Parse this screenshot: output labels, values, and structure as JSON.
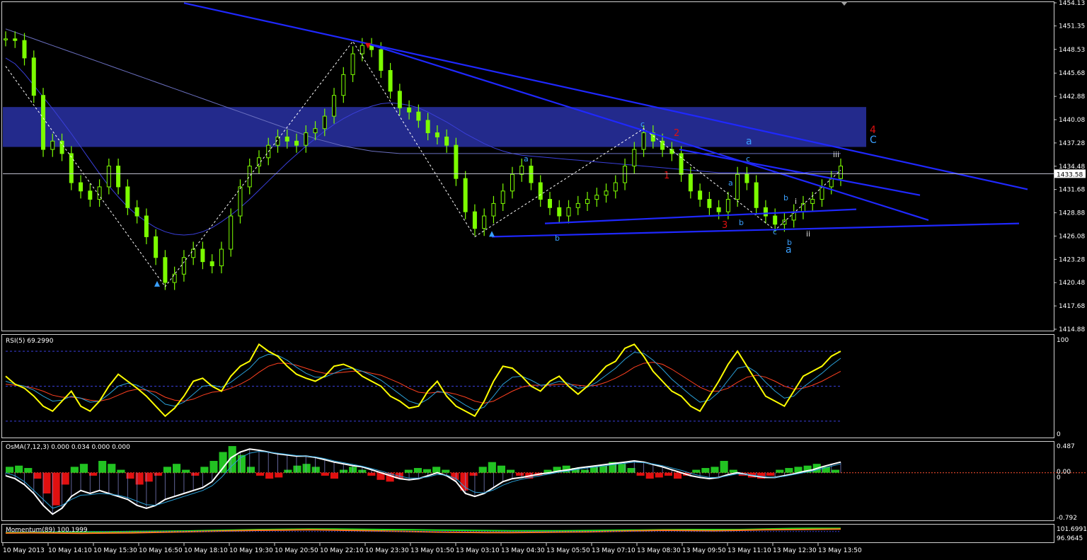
{
  "chart_data": [
    {
      "type": "candlestick",
      "panel": "price",
      "ylim": [
        1414.88,
        1454.13
      ],
      "y_ticks": [
        "1454.13",
        "1451.35",
        "1448.53",
        "1445.68",
        "1442.88",
        "1440.08",
        "1437.28",
        "1434.48",
        "1431.68",
        "1428.88",
        "1426.08",
        "1423.28",
        "1420.48",
        "1417.68",
        "1414.88"
      ],
      "current_price": "1433.58",
      "series": [
        {
          "name": "close",
          "values": [
            1449.8,
            1449.6,
            1447.5,
            1443.0,
            1436.5,
            1437.5,
            1436.0,
            1432.5,
            1431.5,
            1430.5,
            1432.0,
            1434.5,
            1432.0,
            1429.5,
            1428.5,
            1426.0,
            1423.5,
            1420.5,
            1421.5,
            1423.5,
            1424.5,
            1423.0,
            1422.5,
            1424.5,
            1428.5,
            1432.0,
            1434.5,
            1435.5,
            1437.0,
            1438.0,
            1437.5,
            1437.0,
            1438.5,
            1439.0,
            1440.5,
            1443.0,
            1445.5,
            1448.0,
            1449.0,
            1448.5,
            1446.0,
            1443.5,
            1441.5,
            1441.0,
            1440.0,
            1438.5,
            1438.0,
            1437.0,
            1433.0,
            1429.0,
            1427.0,
            1428.5,
            1430.0,
            1431.5,
            1433.5,
            1434.5,
            1432.5,
            1430.5,
            1429.5,
            1428.5,
            1429.5,
            1430.0,
            1430.5,
            1431.0,
            1431.5,
            1432.5,
            1434.5,
            1436.5,
            1438.5,
            1437.5,
            1436.5,
            1436.0,
            1433.5,
            1431.5,
            1430.5,
            1429.5,
            1429.0,
            1430.5,
            1433.5,
            1432.5,
            1429.5,
            1428.5,
            1427.5,
            1428.0,
            1429.0,
            1430.0,
            1430.5,
            1432.0,
            1433.0,
            1434.5
          ]
        },
        {
          "name": "MA1",
          "values": [
            1447.5,
            1446.8,
            1445.6,
            1444.2,
            1442.8,
            1441.4,
            1439.9,
            1438.4,
            1436.8,
            1435.2,
            1433.6,
            1432.1,
            1430.8,
            1429.6,
            1428.6,
            1427.8,
            1427.1,
            1426.6,
            1426.3,
            1426.2,
            1426.3,
            1426.6,
            1427.1,
            1427.8,
            1428.6,
            1429.5,
            1430.5,
            1431.6,
            1432.7,
            1433.8,
            1434.9,
            1435.9,
            1436.9,
            1437.8,
            1438.7,
            1439.5,
            1440.2,
            1440.8,
            1441.3,
            1441.7,
            1442.0,
            1442.1,
            1442.0,
            1441.8,
            1441.5,
            1441.0,
            1440.4,
            1439.8,
            1439.1,
            1438.4,
            1437.8,
            1437.2,
            1436.7,
            1436.3,
            1436.0,
            1435.8,
            1435.7,
            1435.6,
            1435.5,
            1435.4,
            1435.3,
            1435.2,
            1435.1,
            1435.0,
            1434.9,
            1434.8,
            1434.7,
            1434.6,
            1434.5,
            1434.4,
            1434.3,
            1434.2,
            1434.1,
            1434.0,
            1433.9,
            1433.8,
            1433.7,
            1433.7,
            1433.7,
            1433.7,
            1433.7,
            1433.7,
            1433.7,
            1433.7,
            1433.7,
            1433.7,
            1433.8,
            1433.8,
            1433.8,
            1433.8
          ]
        },
        {
          "name": "MA2",
          "values": [
            1451.0,
            1450.6,
            1450.2,
            1449.8,
            1449.4,
            1449.0,
            1448.6,
            1448.2,
            1447.8,
            1447.4,
            1447.0,
            1446.6,
            1446.2,
            1445.8,
            1445.4,
            1445.0,
            1444.6,
            1444.2,
            1443.8,
            1443.4,
            1443.0,
            1442.6,
            1442.2,
            1441.8,
            1441.4,
            1441.0,
            1440.6,
            1440.2,
            1439.8,
            1439.4,
            1439.0,
            1438.6,
            1438.2,
            1437.8,
            1437.5,
            1437.2,
            1436.9,
            1436.7,
            1436.5,
            1436.3,
            1436.2,
            1436.1,
            1436.0,
            1436.0,
            1436.0,
            1436.0,
            1436.0,
            1436.0,
            1436.0,
            1436.0,
            1436.0,
            1436.0,
            1436.0,
            1436.0,
            1436.0,
            1436.0,
            1436.0,
            1436.0,
            1436.0,
            1436.0,
            1436.0,
            1436.0,
            1436.0,
            1436.0,
            1436.0,
            1436.0,
            1436.0,
            1436.0,
            1436.0,
            1436.0,
            1436.0,
            1436.0,
            1436.0,
            1436.0,
            1436.0,
            1436.0,
            1436.0,
            1436.0,
            1436.0,
            1436.0,
            1436.0,
            1436.0,
            1436.0,
            1436.0,
            1436.0,
            1436.0,
            1436.0,
            1436.0,
            1436.0,
            1436.0
          ]
        }
      ],
      "zone": {
        "from": 1436.8,
        "to": 1441.6
      },
      "annotations_red": [
        "4",
        "2",
        "1",
        "3"
      ],
      "annotations_blue": [
        "C",
        "a",
        "a",
        "c",
        "c",
        "a",
        "b",
        "b",
        "b",
        "a",
        "c",
        "b",
        "i",
        "ii",
        "iii"
      ]
    },
    {
      "type": "line",
      "panel": "rsi",
      "title": "RSI(5) 69.2990",
      "ylim": [
        0,
        100
      ],
      "y_ticks": [
        "100",
        "0"
      ],
      "series": [
        {
          "name": "RSI",
          "values": [
            60,
            52,
            48,
            40,
            30,
            25,
            35,
            45,
            30,
            25,
            35,
            50,
            62,
            55,
            48,
            40,
            30,
            20,
            28,
            40,
            55,
            58,
            50,
            45,
            60,
            70,
            75,
            92,
            85,
            80,
            70,
            62,
            58,
            55,
            60,
            70,
            72,
            68,
            60,
            55,
            50,
            40,
            35,
            28,
            30,
            45,
            55,
            40,
            30,
            25,
            20,
            35,
            55,
            70,
            68,
            60,
            50,
            45,
            55,
            60,
            50,
            42,
            50,
            60,
            70,
            75,
            88,
            92,
            80,
            65,
            55,
            45,
            40,
            30,
            25,
            40,
            55,
            72,
            85,
            70,
            55,
            40,
            35,
            30,
            45,
            60,
            65,
            70,
            80,
            85
          ]
        },
        {
          "name": "signal",
          "values": [
            55,
            52,
            50,
            46,
            40,
            35,
            36,
            40,
            38,
            34,
            35,
            42,
            50,
            53,
            51,
            46,
            40,
            32,
            30,
            34,
            42,
            50,
            51,
            49,
            54,
            61,
            68,
            78,
            82,
            81,
            76,
            69,
            63,
            59,
            59,
            63,
            67,
            68,
            65,
            61,
            56,
            49,
            42,
            35,
            32,
            37,
            45,
            43,
            37,
            31,
            26,
            29,
            40,
            52,
            59,
            60,
            56,
            51,
            52,
            55,
            53,
            48,
            49,
            54,
            61,
            68,
            77,
            84,
            83,
            76,
            67,
            57,
            49,
            41,
            34,
            36,
            44,
            56,
            68,
            70,
            64,
            54,
            45,
            38,
            40,
            49,
            56,
            63,
            71,
            78
          ]
        },
        {
          "name": "slow",
          "values": [
            52,
            51,
            50,
            48,
            45,
            41,
            39,
            39,
            38,
            36,
            35,
            37,
            41,
            45,
            47,
            46,
            44,
            39,
            36,
            35,
            37,
            41,
            44,
            45,
            48,
            52,
            57,
            64,
            70,
            73,
            73,
            71,
            68,
            65,
            63,
            63,
            64,
            65,
            65,
            63,
            61,
            57,
            53,
            48,
            44,
            43,
            44,
            44,
            42,
            39,
            35,
            33,
            35,
            40,
            45,
            49,
            51,
            51,
            51,
            52,
            52,
            51,
            50,
            51,
            54,
            58,
            63,
            69,
            73,
            74,
            72,
            67,
            61,
            55,
            49,
            45,
            45,
            48,
            54,
            59,
            61,
            59,
            55,
            50,
            47,
            48,
            51,
            55,
            60,
            65
          ]
        }
      ]
    },
    {
      "type": "bar",
      "panel": "osma",
      "title": "OsMA(7,12,3) 0.000 0.034 0.000 0.000",
      "ylim": [
        -0.792,
        0.487
      ],
      "y_ticks": [
        "0.487",
        "0.00",
        "0",
        "-0.792"
      ],
      "series": [
        {
          "name": "OsMA",
          "values": [
            0.1,
            0.12,
            0.08,
            -0.1,
            -0.35,
            -0.55,
            -0.2,
            0.1,
            0.15,
            -0.05,
            0.2,
            0.15,
            0.05,
            -0.1,
            -0.2,
            -0.15,
            -0.05,
            0.1,
            0.15,
            0.05,
            -0.05,
            0.1,
            0.2,
            0.35,
            0.45,
            0.3,
            0.1,
            -0.05,
            -0.1,
            -0.08,
            0.05,
            0.12,
            0.15,
            0.1,
            -0.05,
            -0.1,
            0.05,
            0.1,
            0.05,
            -0.05,
            -0.12,
            -0.15,
            -0.1,
            0.05,
            0.08,
            0.06,
            0.1,
            0.05,
            -0.12,
            -0.3,
            -0.05,
            0.1,
            0.18,
            0.12,
            0.05,
            -0.05,
            -0.1,
            -0.05,
            0.05,
            0.1,
            0.12,
            0.08,
            0.05,
            0.1,
            0.12,
            0.18,
            0.15,
            0.08,
            -0.05,
            -0.1,
            -0.08,
            -0.05,
            -0.1,
            -0.05,
            0.05,
            0.08,
            0.1,
            0.2,
            0.05,
            -0.05,
            -0.08,
            -0.1,
            -0.05,
            0.05,
            0.08,
            0.1,
            0.12,
            0.15,
            0.1,
            0.05
          ]
        },
        {
          "name": "MACD",
          "values": [
            -0.05,
            -0.1,
            -0.2,
            -0.35,
            -0.55,
            -0.7,
            -0.6,
            -0.4,
            -0.3,
            -0.35,
            -0.3,
            -0.35,
            -0.4,
            -0.45,
            -0.55,
            -0.6,
            -0.55,
            -0.45,
            -0.4,
            -0.35,
            -0.3,
            -0.25,
            -0.15,
            0.05,
            0.25,
            0.35,
            0.4,
            0.38,
            0.35,
            0.32,
            0.3,
            0.28,
            0.28,
            0.26,
            0.22,
            0.18,
            0.15,
            0.12,
            0.1,
            0.05,
            0.0,
            -0.05,
            -0.1,
            -0.12,
            -0.1,
            -0.05,
            0.0,
            -0.05,
            -0.15,
            -0.35,
            -0.4,
            -0.35,
            -0.25,
            -0.15,
            -0.1,
            -0.08,
            -0.05,
            -0.02,
            0.0,
            0.03,
            0.05,
            0.08,
            0.1,
            0.12,
            0.14,
            0.16,
            0.18,
            0.2,
            0.18,
            0.14,
            0.1,
            0.05,
            0.0,
            -0.05,
            -0.08,
            -0.1,
            -0.08,
            -0.03,
            0.0,
            -0.03,
            -0.06,
            -0.08,
            -0.08,
            -0.05,
            -0.02,
            0.02,
            0.05,
            0.1,
            0.14,
            0.18
          ]
        },
        {
          "name": "signal",
          "values": [
            0.0,
            -0.05,
            -0.15,
            -0.3,
            -0.45,
            -0.6,
            -0.55,
            -0.45,
            -0.38,
            -0.37,
            -0.35,
            -0.36,
            -0.38,
            -0.42,
            -0.48,
            -0.54,
            -0.55,
            -0.5,
            -0.45,
            -0.4,
            -0.35,
            -0.3,
            -0.22,
            -0.08,
            0.1,
            0.25,
            0.33,
            0.36,
            0.35,
            0.33,
            0.31,
            0.29,
            0.28,
            0.27,
            0.24,
            0.2,
            0.17,
            0.14,
            0.11,
            0.07,
            0.03,
            -0.02,
            -0.06,
            -0.09,
            -0.09,
            -0.07,
            -0.03,
            -0.04,
            -0.1,
            -0.25,
            -0.33,
            -0.34,
            -0.29,
            -0.21,
            -0.15,
            -0.11,
            -0.08,
            -0.05,
            -0.02,
            0.01,
            0.03,
            0.06,
            0.08,
            0.1,
            0.12,
            0.14,
            0.16,
            0.18,
            0.17,
            0.15,
            0.12,
            0.08,
            0.04,
            -0.01,
            -0.05,
            -0.08,
            -0.08,
            -0.05,
            -0.02,
            -0.03,
            -0.05,
            -0.07,
            -0.08,
            -0.06,
            -0.03,
            0.0,
            0.03,
            0.07,
            0.11,
            0.15
          ]
        }
      ]
    },
    {
      "type": "line",
      "panel": "momentum",
      "title": "Momentum(89) 100.1999",
      "ylim": [
        96.0,
        102.2
      ],
      "y_ticks": [
        "101.6991",
        "96.9645"
      ],
      "series": [
        {
          "name": "green",
          "values": [
            99.6,
            99.7,
            99.8,
            99.9,
            99.9,
            100.0,
            100.1,
            100.2,
            100.4,
            100.6,
            100.8,
            100.9,
            101.0,
            101.0,
            100.9,
            100.8,
            100.7,
            100.6,
            100.5,
            100.4,
            100.3,
            100.3,
            100.3,
            100.4,
            100.5,
            100.6,
            100.7,
            100.8,
            100.8,
            100.8,
            101.0,
            101.2,
            101.3,
            101.3
          ]
        },
        {
          "name": "orange",
          "values": [
            99.4,
            99.5,
            99.4,
            99.3,
            99.4,
            99.5,
            99.7,
            99.9,
            100.1,
            100.3,
            100.5,
            100.6,
            100.7,
            100.6,
            100.4,
            100.2,
            100.0,
            99.8,
            99.7,
            99.6,
            99.6,
            99.7,
            99.8,
            99.9,
            100.1,
            100.3,
            100.5,
            100.4,
            100.3,
            100.5,
            100.7,
            100.8,
            100.9,
            101.0
          ]
        }
      ]
    }
  ],
  "x_axis_labels": [
    "10 May 2013",
    "10 May 14:10",
    "10 May 15:30",
    "10 May 16:50",
    "10 May 18:10",
    "10 May 19:30",
    "10 May 20:50",
    "10 May 22:10",
    "10 May 23:30",
    "13 May 01:50",
    "13 May 03:10",
    "13 May 04:30",
    "13 May 05:50",
    "13 May 07:10",
    "13 May 08:30",
    "13 May 09:50",
    "13 May 11:10",
    "13 May 12:30",
    "13 May 13:50"
  ],
  "colors": {
    "candle": "#7CFC00",
    "ma1": "#3a3fd9",
    "ma2": "#6a6fbf",
    "trendline": "#1f28ff",
    "zone": "#232a8c",
    "rsi": "#ffff00",
    "osma_up": "#22c322",
    "osma_down": "#e01010",
    "macd": "#ffffff",
    "signal": "#2aa0d8",
    "mom_green": "#20e020",
    "mom_orange": "#ff7a20",
    "red_label": "#e01010",
    "blue_label": "#3aa0ff"
  }
}
